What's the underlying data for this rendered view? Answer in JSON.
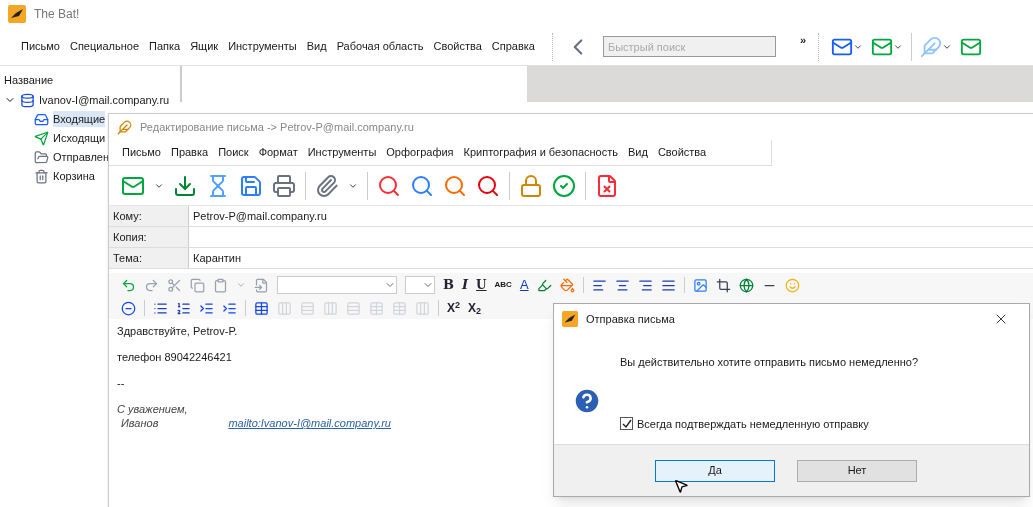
{
  "main_window": {
    "title": "The Bat!",
    "menu": [
      "Письмо",
      "Специальное",
      "Папка",
      "Ящик",
      "Инструменты",
      "Вид",
      "Рабочая область",
      "Свойства",
      "Справка"
    ],
    "search": {
      "placeholder": "Быстрый поиск"
    },
    "overflow": "»"
  },
  "sidebar": {
    "header": "Название",
    "tree": [
      {
        "label": "Ivanov-I@mail.company.ru",
        "kind": "account",
        "expanded": true,
        "selected": false,
        "children": [
          {
            "label": "Входящие",
            "kind": "inbox",
            "selected": true
          },
          {
            "label": "Исходящи",
            "kind": "outbox",
            "selected": false
          },
          {
            "label": "Отправлен",
            "kind": "sent",
            "selected": false
          },
          {
            "label": "Корзина",
            "kind": "trash",
            "selected": false
          }
        ]
      }
    ]
  },
  "editor": {
    "title": "Редактирование письма -> Petrov-P@mail.company.ru",
    "menu": [
      "Письмо",
      "Правка",
      "Поиск",
      "Формат",
      "Инструменты",
      "Орфография",
      "Криптография и безопасность",
      "Вид",
      "Свойства"
    ],
    "fields": [
      {
        "label": "Кому:",
        "value": "Petrov-P@mail.company.ru"
      },
      {
        "label": "Копия:"
      },
      {
        "label": "Тема:",
        "value": "Карантин"
      }
    ],
    "format_text": [
      "B",
      "I",
      "U",
      "ABC",
      "A"
    ],
    "script_buttons": [
      "X$^{2}$",
      "X$_{2}$"
    ],
    "body": {
      "lines": [
        {
          "text": "Здравствуйте, Petrov-P.",
          "kind": "plain"
        },
        {
          "text": "телефон 89042246421",
          "kind": "plain"
        },
        {
          "text": "--",
          "kind": "plain"
        },
        {
          "text": "С уважением,",
          "kind": "signature"
        }
      ],
      "signature_name": "Иванов",
      "link": "mailto:Ivanov-I@mail.company.ru"
    }
  },
  "dialog": {
    "title": "Отправка письма",
    "message": "Вы действительно хотите отправить письмо немедленно?",
    "checkbox": {
      "label": "Всегда подтверждать немедленную отправку",
      "checked": true
    },
    "buttons": [
      {
        "label": "Да",
        "selected": true
      },
      {
        "label": "Нет",
        "selected": false
      }
    ]
  }
}
